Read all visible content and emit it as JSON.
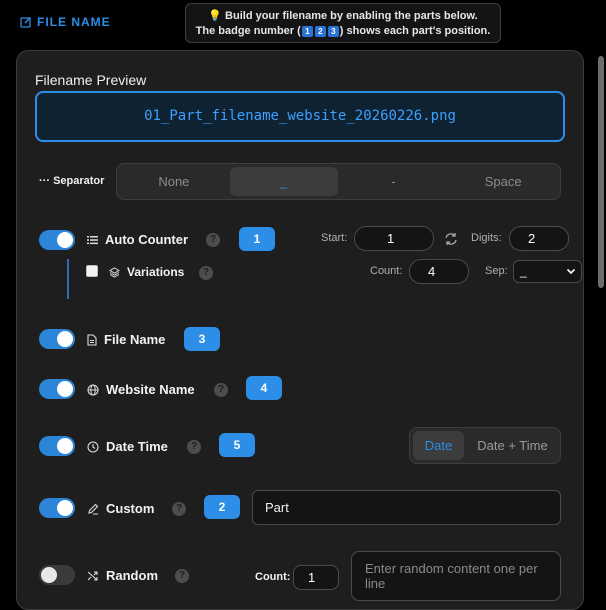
{
  "header": {
    "title": "FILE NAME",
    "hint_line1": "💡 Build your filename by enabling the parts below.",
    "hint_line2_pre": "The badge number (",
    "hint_badges": [
      "1",
      "2",
      "3"
    ],
    "hint_line2_post": ") shows each part's position."
  },
  "preview": {
    "label": "Filename Preview",
    "value": "01_Part_filename_website_20260226.png"
  },
  "separator": {
    "label": "Separator",
    "options": [
      "None",
      "_",
      "-",
      "Space"
    ],
    "selected": "_"
  },
  "auto_counter": {
    "enabled": true,
    "label": "Auto Counter",
    "help": "?",
    "badge": "1",
    "start_label": "Start:",
    "start_value": "1",
    "digits_label": "Digits:",
    "digits_value": "2",
    "variations": {
      "checked": false,
      "label": "Variations",
      "help": "?",
      "count_label": "Count:",
      "count_value": "4",
      "sep_label": "Sep:",
      "sep_value": "_"
    }
  },
  "file_name": {
    "enabled": true,
    "label": "File Name",
    "badge": "3"
  },
  "website_name": {
    "enabled": true,
    "label": "Website Name",
    "help": "?",
    "badge": "4"
  },
  "date_time": {
    "enabled": true,
    "label": "Date Time",
    "help": "?",
    "badge": "5",
    "options": [
      "Date",
      "Date + Time"
    ],
    "selected": "Date"
  },
  "custom": {
    "enabled": true,
    "label": "Custom",
    "help": "?",
    "badge": "2",
    "value": "Part"
  },
  "random": {
    "enabled": false,
    "label": "Random",
    "help": "?",
    "count_label": "Count:",
    "count_value": "1",
    "placeholder": "Enter random content one per line"
  },
  "colors": {
    "accent": "#2d8ee8",
    "panel": "#1e1e1e",
    "background": "#000000"
  }
}
